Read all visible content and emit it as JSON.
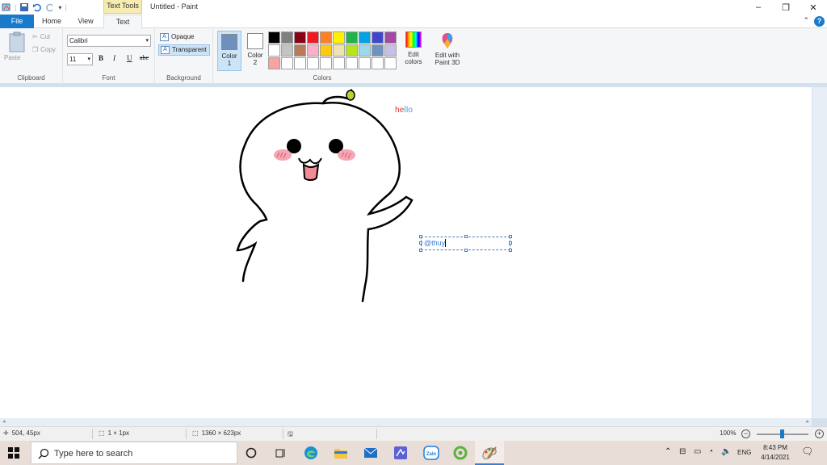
{
  "window": {
    "title": "Untitled - Paint",
    "context_tab": "Text Tools",
    "controls": [
      "–",
      "❐",
      "✕"
    ]
  },
  "tabs": {
    "file": "File",
    "home": "Home",
    "view": "View",
    "text": "Text"
  },
  "clipboard": {
    "paste": "Paste",
    "cut": "Cut",
    "copy": "Copy",
    "label": "Clipboard"
  },
  "font": {
    "family": "Calibri",
    "size": "11",
    "bold": "B",
    "italic": "I",
    "underline": "U",
    "strike": "abc",
    "label": "Font"
  },
  "background": {
    "opaque": "Opaque",
    "transparent": "Transparent",
    "label": "Background"
  },
  "colors": {
    "color1_label": "Color",
    "color1_num": "1",
    "color2_label": "Color",
    "color2_num": "2",
    "color1_value": "#6f8fbd",
    "color2_value": "#ffffff",
    "edit_line1": "Edit",
    "edit_line2": "colors",
    "p3d_line1": "Edit with",
    "p3d_line2": "Paint 3D",
    "label": "Colors",
    "palette": [
      "#000000",
      "#7f7f7f",
      "#880015",
      "#ed1c24",
      "#ff7f27",
      "#fff200",
      "#22b14c",
      "#00a2e8",
      "#3f48cc",
      "#a349a4",
      "#ffffff",
      "#c3c3c3",
      "#b97a57",
      "#ffaec9",
      "#ffc90e",
      "#efe4b0",
      "#b5e61d",
      "#99d9ea",
      "#7092be",
      "#c8bfe7",
      "#f5a3a3",
      "#ffffff",
      "#ffffff",
      "#ffffff",
      "#ffffff",
      "#ffffff",
      "#ffffff",
      "#ffffff",
      "#ffffff",
      "#ffffff"
    ]
  },
  "canvas": {
    "hello_chars": [
      {
        "ch": "h",
        "color": "#d9342b"
      },
      {
        "ch": "e",
        "color": "#d9342b"
      },
      {
        "ch": "l",
        "color": "#3c9be0"
      },
      {
        "ch": "l",
        "color": "#3c9be0"
      },
      {
        "ch": "o",
        "color": "#3c9be0"
      }
    ],
    "textbox_text": "@thuy"
  },
  "status": {
    "cursor": "504, 45px",
    "selection": "1 × 1px",
    "size": "1360 × 623px",
    "zoom": "100%"
  },
  "taskbar": {
    "search_placeholder": "Type here to search",
    "lang": "ENG",
    "time": "8:43 PM",
    "date": "4/14/2021",
    "zalo": "Zalo"
  }
}
